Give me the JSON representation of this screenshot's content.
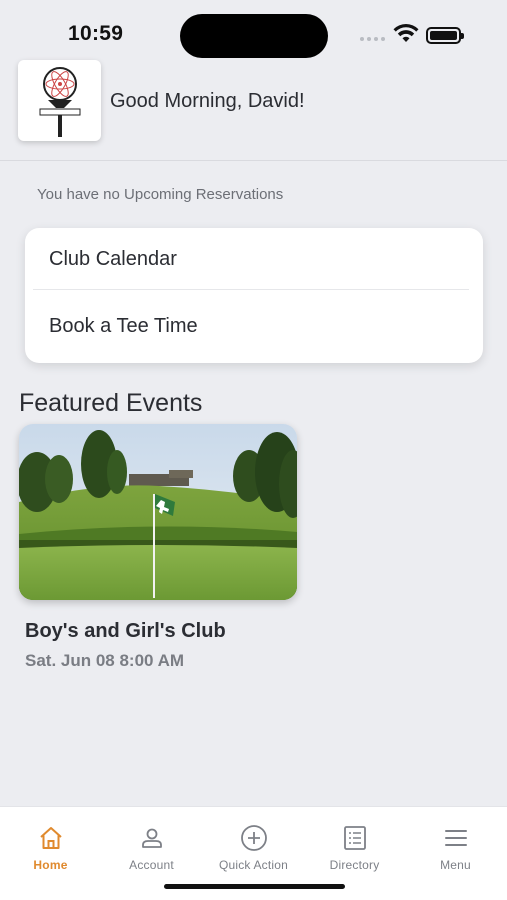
{
  "status_bar": {
    "time": "10:59"
  },
  "header": {
    "greeting": "Good Morning, David!"
  },
  "reservations": {
    "message": "You have no Upcoming Reservations"
  },
  "quick_links": [
    {
      "label": "Club Calendar"
    },
    {
      "label": "Book a Tee Time"
    }
  ],
  "featured": {
    "title": "Featured Events",
    "events": [
      {
        "title": "Boy's and Girl's Club",
        "date": "Sat. Jun 08 8:00 AM"
      }
    ]
  },
  "tab_bar": {
    "active": "Home",
    "accent_color": "#e08a2e",
    "tabs": [
      {
        "label": "Home",
        "icon": "home-icon"
      },
      {
        "label": "Account",
        "icon": "person-icon"
      },
      {
        "label": "Quick Action",
        "icon": "plus-circle-icon"
      },
      {
        "label": "Directory",
        "icon": "list-icon"
      },
      {
        "label": "Menu",
        "icon": "menu-icon"
      }
    ]
  }
}
